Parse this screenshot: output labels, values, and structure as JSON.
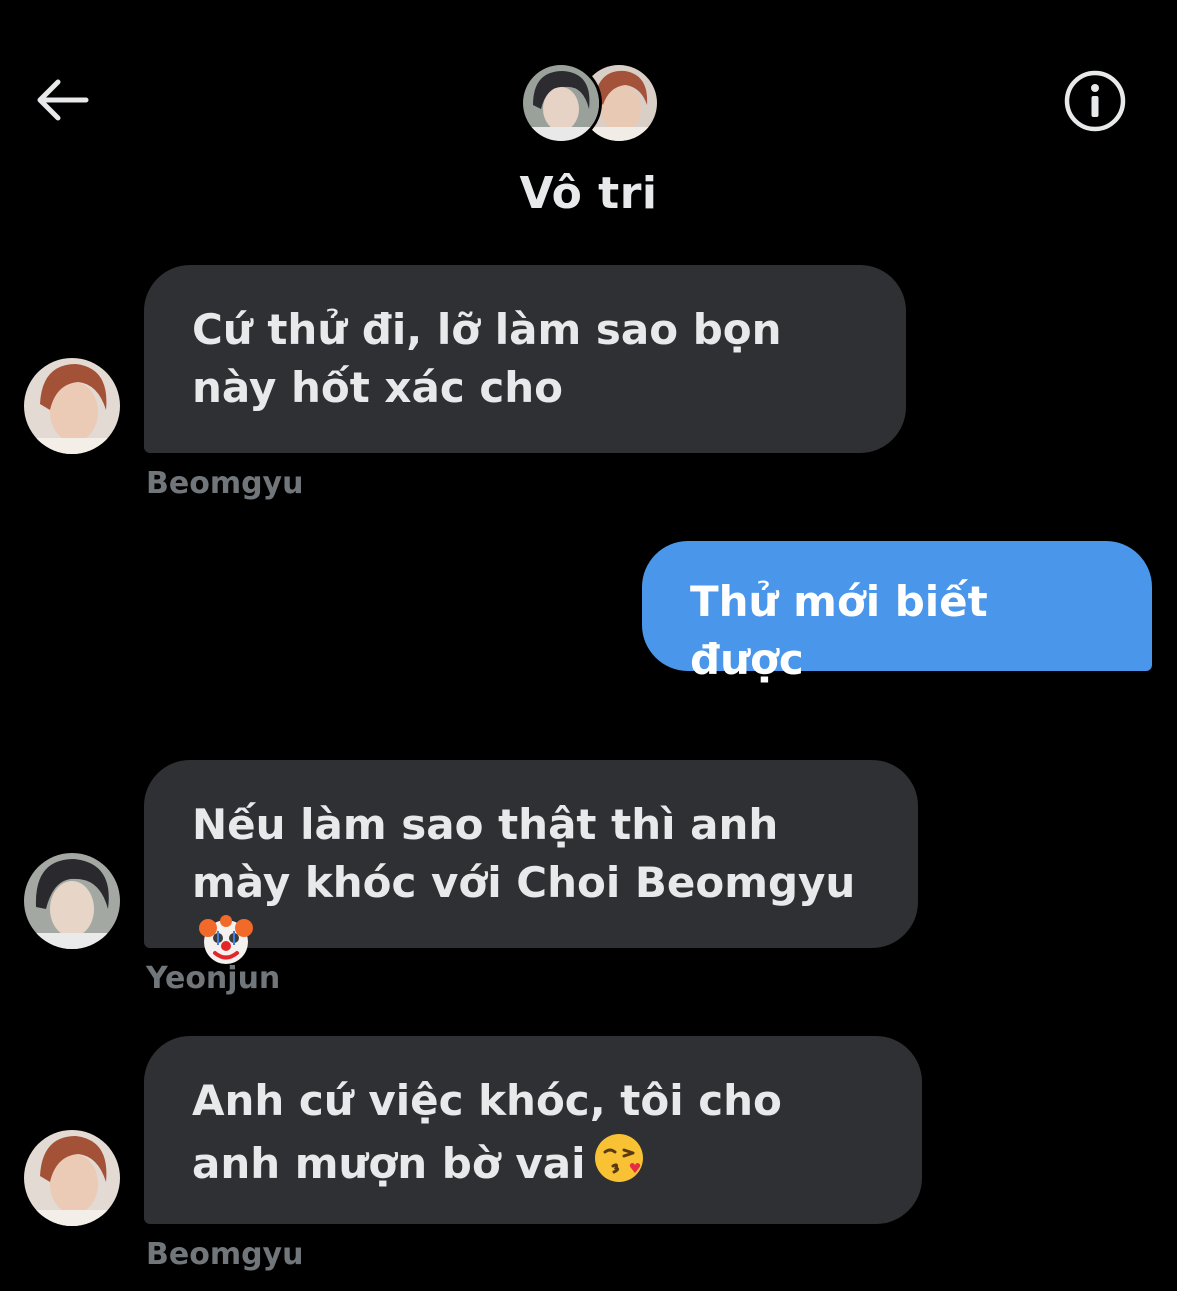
{
  "header": {
    "back_icon": "arrow-left-icon",
    "info_icon": "info-circle-icon",
    "title": "Vô tri"
  },
  "messages": [
    {
      "direction": "incoming",
      "text": "Cứ thử đi, lỡ làm sao bọn này hốt xác cho",
      "sender": "Beomgyu",
      "emoji": ""
    },
    {
      "direction": "outgoing",
      "text": "Thử mới biết được"
    },
    {
      "direction": "incoming",
      "text": "Nếu làm sao thật thì anh mày khóc với Choi Beomgyu",
      "sender": "Yeonjun",
      "emoji": "clown-face-icon"
    },
    {
      "direction": "incoming",
      "text": "Anh cứ việc khóc, tôi cho anh mượn bờ vai",
      "sender": "Beomgyu",
      "emoji": "face-blowing-kiss-icon"
    }
  ],
  "colors": {
    "background": "#000000",
    "incoming_bubble": "#2f3033",
    "outgoing_bubble": "#4a96ea",
    "text": "#e7e9ea",
    "secondary_text": "#71767b"
  }
}
